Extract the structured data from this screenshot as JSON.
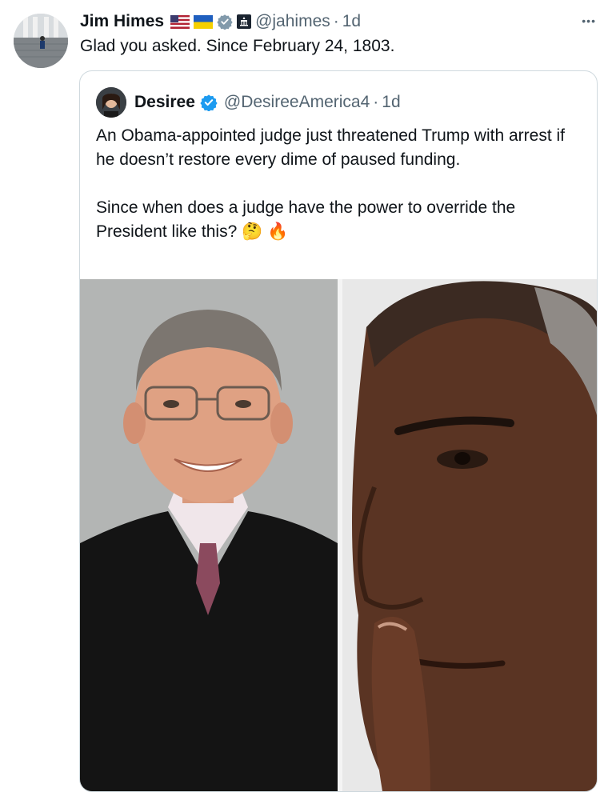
{
  "tweet": {
    "author_name": "Jim Himes",
    "handle": "@jahimes",
    "separator": "·",
    "time": "1d",
    "text": "Glad you asked.  Since February 24, 1803.",
    "header_icons": [
      "us-flag-icon",
      "ukraine-flag-icon",
      "verified-gray-icon",
      "capitol-badge-icon"
    ],
    "more_label": "•••"
  },
  "quoted": {
    "author_name": "Desiree",
    "handle": "@DesireeAmerica4",
    "separator": "·",
    "time": "1d",
    "verified_icon": "verified-blue-icon",
    "text": "An Obama-appointed judge just threatened Trump with arrest if he doesn’t restore every dime of paused funding.\n\nSince when does a judge have the power to override the President like this? 🤔 🔥",
    "media": [
      "judge-portrait",
      "obama-closeup"
    ]
  },
  "colors": {
    "text": "#0f1419",
    "secondary": "#536471",
    "border": "#cfd9de",
    "verified_blue": "#1d9bf0"
  }
}
